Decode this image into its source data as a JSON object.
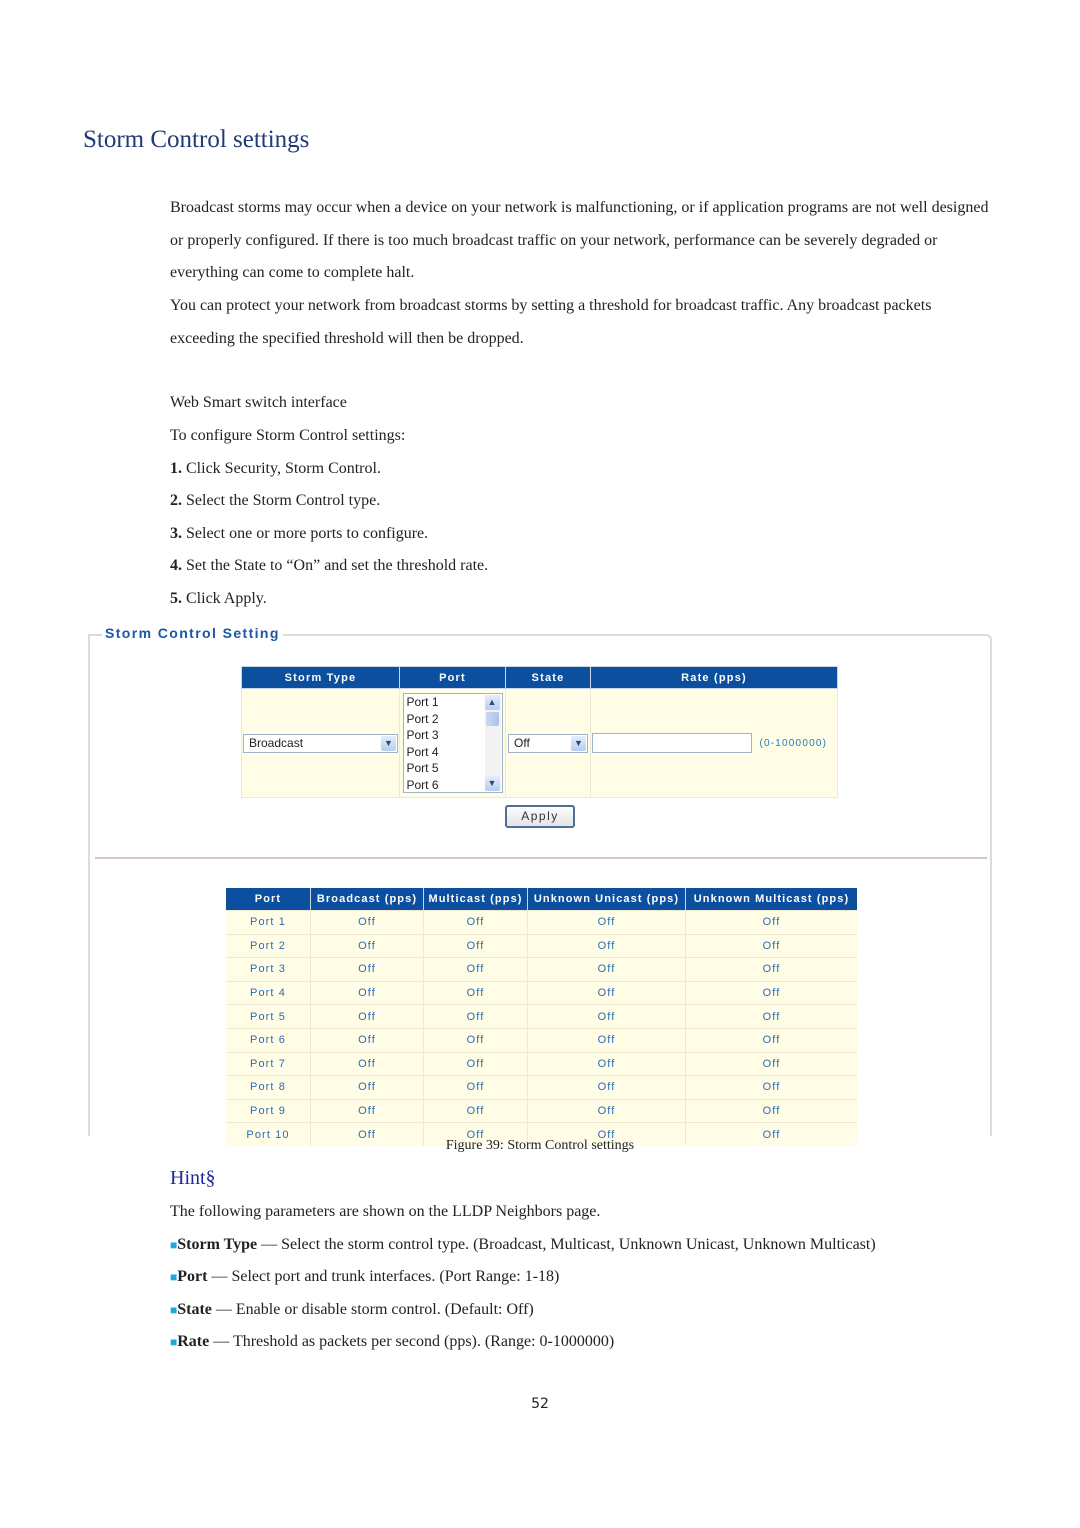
{
  "heading": "Storm Control settings",
  "intro": {
    "p1": "Broadcast storms may occur when a device on your network is malfunctioning, or if application programs are not well designed or properly configured. If there is too much broadcast traffic on your network, performance can be severely degraded or everything can come to complete halt.",
    "p2": "You can protect your network from broadcast storms by setting a threshold for broadcast traffic. Any broadcast packets exceeding the specified threshold will then be dropped."
  },
  "interface_label": "Web Smart switch interface",
  "steps_intro": "To configure Storm Control settings:",
  "steps": [
    {
      "num": "1.",
      "text": " Click Security, Storm Control."
    },
    {
      "num": "2.",
      "text": " Select the Storm Control type."
    },
    {
      "num": "3.",
      "text": " Select one or more ports to configure."
    },
    {
      "num": "4.",
      "text": " Set the State to “On” and set the threshold rate."
    },
    {
      "num": "5.",
      "text": " Click Apply."
    }
  ],
  "widget": {
    "legend": "Storm Control Setting",
    "config_headers": [
      "Storm Type",
      "Port",
      "State",
      "Rate (pps)"
    ],
    "storm_type_value": "Broadcast",
    "port_options": [
      "Port 1",
      "Port 2",
      "Port 3",
      "Port 4",
      "Port 5",
      "Port 6"
    ],
    "state_value": "Off",
    "rate_value": "",
    "rate_range_hint": "(0-1000000)",
    "apply_label": "Apply",
    "status_headers": [
      "Port",
      "Broadcast (pps)",
      "Multicast (pps)",
      "Unknown Unicast (pps)",
      "Unknown Multicast (pps)"
    ],
    "status_rows": [
      [
        "Port 1",
        "Off",
        "Off",
        "Off",
        "Off"
      ],
      [
        "Port 2",
        "Off",
        "Off",
        "Off",
        "Off"
      ],
      [
        "Port 3",
        "Off",
        "Off",
        "Off",
        "Off"
      ],
      [
        "Port 4",
        "Off",
        "Off",
        "Off",
        "Off"
      ],
      [
        "Port 5",
        "Off",
        "Off",
        "Off",
        "Off"
      ],
      [
        "Port 6",
        "Off",
        "Off",
        "Off",
        "Off"
      ],
      [
        "Port 7",
        "Off",
        "Off",
        "Off",
        "Off"
      ],
      [
        "Port 8",
        "Off",
        "Off",
        "Off",
        "Off"
      ],
      [
        "Port 9",
        "Off",
        "Off",
        "Off",
        "Off"
      ],
      [
        "Port 10",
        "Off",
        "Off",
        "Off",
        "Off"
      ]
    ]
  },
  "caption": "Figure 39: Storm Control settings",
  "hint": {
    "title": "Hint§",
    "intro": "The following parameters are shown on the LLDP Neighbors page.",
    "bullet_glyph": "■",
    "items": [
      {
        "term": "Storm Type",
        "desc": " — Select the storm control type. (Broadcast, Multicast, Unknown Unicast, Unknown Multicast)"
      },
      {
        "term": "Port",
        "desc": " — Select port and trunk interfaces. (Port Range: 1-18)"
      },
      {
        "term": "State",
        "desc": " — Enable or disable storm control. (Default: Off)"
      },
      {
        "term": "Rate",
        "desc": " — Threshold as packets per second (pps). (Range: 0-1000000)"
      }
    ]
  },
  "page_number": "52",
  "colors": {
    "heading": "#1f3a78",
    "table_header": "#0b4f9e",
    "table_cell": "#fffde6",
    "cell_text": "#2a6bb5",
    "bullet": "#1aa7e6"
  }
}
